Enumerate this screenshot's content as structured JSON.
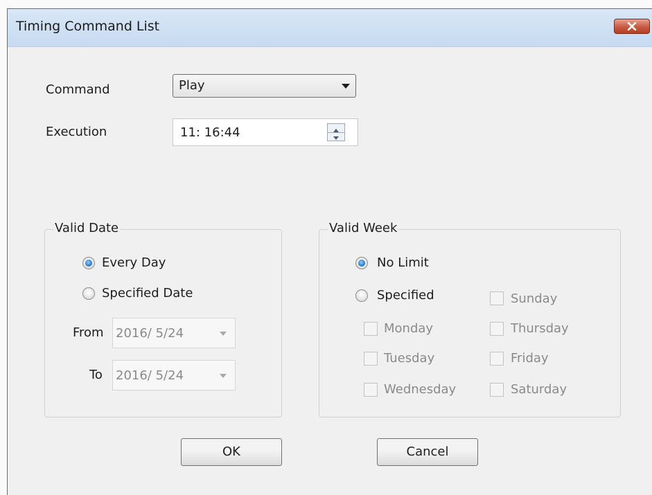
{
  "window": {
    "title": "Timing Command List"
  },
  "command": {
    "label": "Command",
    "value": "Play"
  },
  "execution": {
    "label": "Execution",
    "value": "11: 16:44"
  },
  "valid_date": {
    "title": "Valid Date",
    "options": [
      {
        "label": "Every Day",
        "selected": true
      },
      {
        "label": "Specified Date",
        "selected": false
      }
    ],
    "from_label": "From",
    "from_value": "2016/  5/24",
    "to_label": "To",
    "to_value": "2016/  5/24"
  },
  "valid_week": {
    "title": "Valid Week",
    "options": [
      {
        "label": "No Limit",
        "selected": true
      },
      {
        "label": "Specified",
        "selected": false
      }
    ],
    "days": {
      "sunday": "Sunday",
      "monday": "Monday",
      "tuesday": "Tuesday",
      "wednesday": "Wednesday",
      "thursday": "Thursday",
      "friday": "Friday",
      "saturday": "Saturday"
    }
  },
  "buttons": {
    "ok": "OK",
    "cancel": "Cancel"
  },
  "colors": {
    "selected_radio": "#1f6fc0",
    "titlebar": "#c6daf1",
    "close_button": "#c75a43"
  }
}
